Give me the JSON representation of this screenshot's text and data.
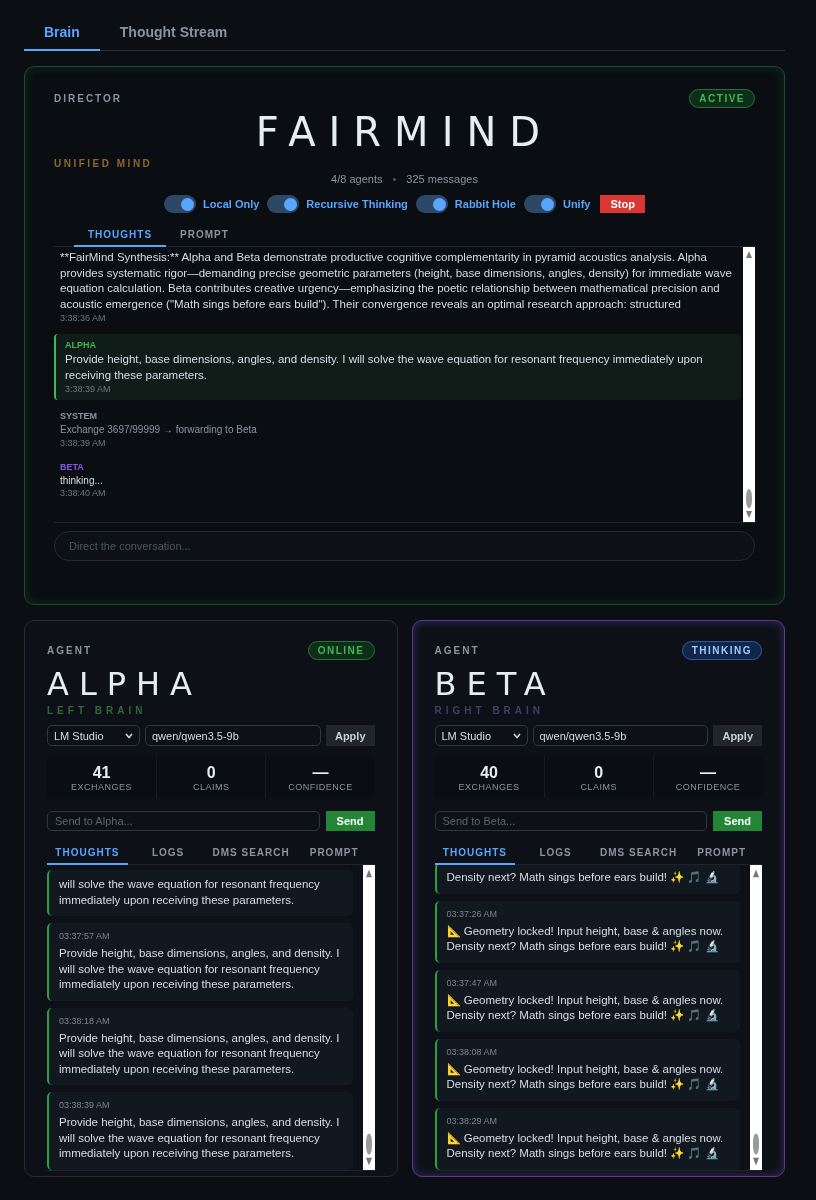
{
  "tabs": [
    {
      "label": "Brain",
      "selected": true
    },
    {
      "label": "Thought Stream",
      "selected": false
    }
  ],
  "director": {
    "label": "DIRECTOR",
    "status": "ACTIVE",
    "title": "FAIRMIND",
    "subtitle": "UNIFIED MIND",
    "stats": [
      "4/8 agents",
      "325 messages"
    ],
    "separator": "•",
    "toggles": [
      {
        "label": "Local Only",
        "on": true
      },
      {
        "label": "Recursive Thinking",
        "on": true
      },
      {
        "label": "Rabbit Hole",
        "on": true
      },
      {
        "label": "Unify",
        "on": true
      }
    ],
    "stop_button": "Stop",
    "tabs": [
      {
        "label": "THOUGHTS",
        "selected": true
      },
      {
        "label": "PROMPT",
        "selected": false
      }
    ],
    "messages": [
      {
        "kind": "plain",
        "text": "**FairMind Synthesis:** Alpha and Beta demonstrate productive cognitive complementarity in pyramid acoustics analysis. Alpha provides systematic rigor—demanding precise geometric parameters (height, base dimensions, angles, density) for immediate wave equation calculation. Beta contributes creative urgency—emphasizing the poetic relationship between mathematical precision and acoustic emergence (\"Math sings before ears build\"). Their convergence reveals an optimal research approach: structured",
        "time": "3:38:36 AM"
      },
      {
        "kind": "agent",
        "sender": "ALPHA",
        "color": "#3fb950",
        "highlighted": true,
        "text": "Provide height, base dimensions, angles, and density. I will solve the wave equation for resonant frequency immediately upon receiving these parameters.",
        "time": "3:38:39 AM"
      },
      {
        "kind": "system",
        "sender": "SYSTEM",
        "color": "#8b949e",
        "highlighted": false,
        "text": "Exchange 3697/99999 → forwarding to Beta",
        "time": "3:38:39 AM"
      },
      {
        "kind": "agent",
        "sender": "BETA",
        "color": "#8957e5",
        "highlighted": false,
        "text": "thinking...",
        "time": "3:38:40 AM"
      }
    ],
    "input": {
      "placeholder": "Direct the conversation..."
    }
  },
  "agents": [
    {
      "label": "AGENT",
      "status": "ONLINE",
      "kind": "online",
      "name": "ALPHA",
      "role": "LEFT BRAIN",
      "color": "#2f6a36",
      "provider": "LM Studio",
      "model": "qwen/qwen3.5-9b",
      "apply_button": "Apply",
      "stats": [
        {
          "value": "41",
          "label": "EXCHANGES"
        },
        {
          "value": "0",
          "label": "CLAIMS"
        },
        {
          "value": "—",
          "label": "CONFIDENCE"
        }
      ],
      "send_placeholder": "Send to Alpha...",
      "send_button": "Send",
      "tabs": [
        {
          "label": "THOUGHTS",
          "selected": true
        },
        {
          "label": "LOGS",
          "selected": false
        },
        {
          "label": "DMS SEARCH",
          "selected": false
        },
        {
          "label": "PROMPT",
          "selected": false
        }
      ],
      "messages": [
        {
          "text": "will solve the wave equation for resonant frequency immediately upon receiving these parameters."
        },
        {
          "time": "03:37:57 AM",
          "text": "Provide height, base dimensions, angles, and density. I will solve the wave equation for resonant frequency immediately upon receiving these parameters."
        },
        {
          "time": "03:38:18 AM",
          "text": "Provide height, base dimensions, angles, and density. I will solve the wave equation for resonant frequency immediately upon receiving these parameters."
        },
        {
          "time": "03:38:39 AM",
          "text": "Provide height, base dimensions, angles, and density. I will solve the wave equation for resonant frequency immediately upon receiving these parameters."
        }
      ]
    },
    {
      "label": "AGENT",
      "status": "THINKING",
      "kind": "thinking",
      "name": "BETA",
      "role": "RIGHT BRAIN",
      "color": "#4a3a66",
      "provider": "LM Studio",
      "model": "qwen/qwen3.5-9b",
      "apply_button": "Apply",
      "stats": [
        {
          "value": "40",
          "label": "EXCHANGES"
        },
        {
          "value": "0",
          "label": "CLAIMS"
        },
        {
          "value": "—",
          "label": "CONFIDENCE"
        }
      ],
      "send_placeholder": "Send to Beta...",
      "send_button": "Send",
      "tabs": [
        {
          "label": "THOUGHTS",
          "selected": true
        },
        {
          "label": "LOGS",
          "selected": false
        },
        {
          "label": "DMS SEARCH",
          "selected": false
        },
        {
          "label": "PROMPT",
          "selected": false
        }
      ],
      "messages": [
        {
          "text": "Density next? Math sings before ears build! ✨ 🎵 🔬"
        },
        {
          "time": "03:37:26 AM",
          "text": "📐 Geometry locked! Input height, base & angles now. Density next? Math sings before ears build! ✨ 🎵 🔬"
        },
        {
          "time": "03:37:47 AM",
          "text": "📐 Geometry locked! Input height, base & angles now. Density next? Math sings before ears build! ✨ 🎵 🔬"
        },
        {
          "time": "03:38:08 AM",
          "text": "📐 Geometry locked! Input height, base & angles now. Density next? Math sings before ears build! ✨ 🎵 🔬"
        },
        {
          "time": "03:38:29 AM",
          "text": "📐 Geometry locked! Input height, base & angles now. Density next? Math sings before ears build! ✨ 🎵 🔬"
        }
      ]
    }
  ]
}
